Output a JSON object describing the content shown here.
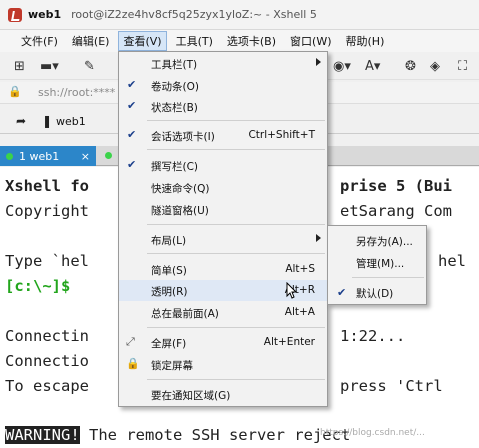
{
  "window": {
    "app_name": "web1",
    "title": "root@iZ2ze4hv8cf5q25zyx1yloZ:~ - Xshell 5"
  },
  "menubar": [
    {
      "label": "文件(F)"
    },
    {
      "label": "编辑(E)"
    },
    {
      "label": "查看(V)",
      "active": true
    },
    {
      "label": "工具(T)"
    },
    {
      "label": "选项卡(B)"
    },
    {
      "label": "窗口(W)"
    },
    {
      "label": "帮助(H)"
    }
  ],
  "address": {
    "text": "ssh://root:****"
  },
  "session_bar": {
    "label": "web1"
  },
  "tabs": [
    {
      "label": "1 web1",
      "close": "×"
    }
  ],
  "terminal": {
    "lines": [
      "Xshell fo",
      "Copyright",
      "",
      "Type `hel",
      "[c:\\~]$",
      "",
      "Connectin",
      "Connectio",
      "To escape"
    ],
    "right_fragments": [
      "prise 5 (Bui",
      "etSarang Com",
      "hel",
      "1:22...",
      "press 'Ctrl"
    ],
    "warning_label": "WARNING!",
    "warning_text": " The remote SSH server reject"
  },
  "view_menu": [
    {
      "label": "工具栏(T)",
      "submenu": true
    },
    {
      "label": "卷动条(O)",
      "checked": true
    },
    {
      "label": "状态栏(B)",
      "checked": true
    },
    {
      "label": "会话选项卡(I)",
      "checked": true,
      "shortcut": "Ctrl+Shift+T"
    },
    {
      "label": "撰写栏(C)",
      "checked": true
    },
    {
      "label": "快速命令(Q)"
    },
    {
      "label": "隧道窗格(U)"
    },
    {
      "label": "布局(L)",
      "submenu": true
    },
    {
      "label": "简单(S)",
      "shortcut": "Alt+S"
    },
    {
      "label": "透明(R)",
      "shortcut": "Alt+R",
      "highlighted": true
    },
    {
      "label": "总在最前面(A)",
      "shortcut": "Alt+A"
    },
    {
      "label": "全屏(F)",
      "shortcut": "Alt+Enter",
      "icon": "fullscreen-icon"
    },
    {
      "label": "锁定屏幕",
      "icon": "lock-icon"
    },
    {
      "label": "要在通知区域(G)"
    }
  ],
  "transparency_submenu": [
    {
      "label": "另存为(A)..."
    },
    {
      "label": "管理(M)..."
    },
    {
      "label": "默认(D)",
      "checked": true
    }
  ],
  "watermark": "https://blog.csdn.net/..."
}
